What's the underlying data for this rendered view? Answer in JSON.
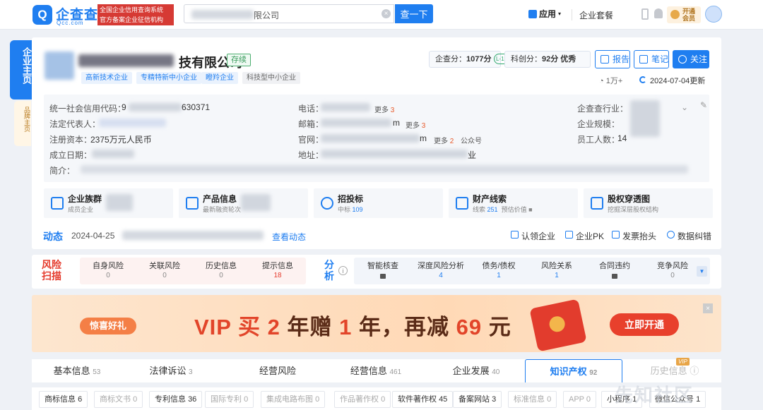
{
  "topbar": {
    "logo_text": "企查查",
    "logo_sub": "Qcc.com",
    "slogan_line1": "全国企业信用查询系统",
    "slogan_line2": "官方备案企业征信机构",
    "search_value": "限公司",
    "search_button": "查一下",
    "apps": "应用",
    "packages": "企业套餐",
    "vip_line1": "开通",
    "vip_line2": "会员"
  },
  "side_tabs": {
    "main": "企业主页",
    "brand": "品牌主页"
  },
  "company": {
    "name_suffix": "技有限公司",
    "status": "存续",
    "tags": [
      "高新技术企业",
      "专精特新中小企业",
      "瞪羚企业",
      "科技型中小企业"
    ],
    "score_label": "企查分：",
    "score_value": "1077分",
    "score_badge": "L-12",
    "tech_label": "科创分：",
    "tech_value": "92分 优秀",
    "btn_report": "报告",
    "btn_note": "笔记",
    "btn_follow": "关注",
    "views": "1万+",
    "updated": "2024-07-04更新"
  },
  "info": {
    "credit_code_label": "统一社会信用代码：",
    "credit_code_prefix": "9",
    "credit_code_suffix": "630371",
    "legal_rep_label": "法定代表人：",
    "capital_label": "注册资本：",
    "capital_value": "2375万元人民币",
    "founded_label": "成立日期：",
    "intro_label": "简介：",
    "phone_label": "电话：",
    "phone_more": "更多",
    "phone_more_count": "3",
    "email_label": "邮箱：",
    "email_tail": "m",
    "email_more": "更多",
    "email_more_count": "3",
    "website_label": "官网：",
    "website_tail": "m",
    "website_more": "更多",
    "website_more_count": "2",
    "website_extra": "公众号",
    "address_label": "地址：",
    "address_tail": "业",
    "industry_label": "企查查行业：",
    "scale_label": "企业规模：",
    "staff_label": "员工人数：",
    "staff_value": "14"
  },
  "quick_cards": [
    {
      "title": "企业族群",
      "sub": "成员企业"
    },
    {
      "title": "产品信息",
      "sub": "最新融资轮次"
    },
    {
      "title": "招投标",
      "sub_pre": "中标",
      "sub_num": "109"
    },
    {
      "title": "财产线索",
      "sub_pre": "线索",
      "sub_num": "251",
      "sub_post": "预估价值"
    },
    {
      "title": "股权穿透图",
      "sub": "挖掘深层股权结构"
    }
  ],
  "dynamic": {
    "title": "动态",
    "date": "2024-04-25",
    "link": "查看动态",
    "actions": [
      "认领企业",
      "企业PK",
      "发票抬头",
      "数据纠错"
    ]
  },
  "risk": {
    "title": "风险扫描",
    "items": [
      {
        "label": "自身风险",
        "n": "0"
      },
      {
        "label": "关联风险",
        "n": "0"
      },
      {
        "label": "历史信息",
        "n": "0"
      },
      {
        "label": "提示信息",
        "n": "18"
      }
    ]
  },
  "analysis": {
    "title": "分析",
    "items": [
      {
        "label": "智能核查",
        "n": ""
      },
      {
        "label": "深度风险分析",
        "n": "4"
      },
      {
        "label": "债务/债权",
        "n": "1"
      },
      {
        "label": "风险关系",
        "n": "1"
      },
      {
        "label": "合同违约",
        "n": ""
      },
      {
        "label": "竞争风险",
        "n": "0"
      }
    ]
  },
  "banner": {
    "tag": "惊喜好礼",
    "text_a": "VIP 买 ",
    "text_b": "2",
    "text_c": " 年赠 ",
    "text_d": "1",
    "text_e": " 年，再减 ",
    "text_f": "69",
    "text_g": " 元",
    "button": "立即开通"
  },
  "tabs": [
    {
      "label": "基本信息",
      "n": "53"
    },
    {
      "label": "法律诉讼",
      "n": "3"
    },
    {
      "label": "经营风险",
      "n": ""
    },
    {
      "label": "经营信息",
      "n": "461"
    },
    {
      "label": "企业发展",
      "n": "40"
    },
    {
      "label": "知识产权",
      "n": "92"
    },
    {
      "label": "历史信息",
      "n": ""
    }
  ],
  "tab_vip": "VIP",
  "subtabs": [
    {
      "label": "商标信息",
      "n": "6"
    },
    {
      "label": "商标文书",
      "n": "0"
    },
    {
      "label": "专利信息",
      "n": "36"
    },
    {
      "label": "国际专利",
      "n": "0"
    },
    {
      "label": "集成电路布图",
      "n": "0"
    },
    {
      "label": "作品著作权",
      "n": "0"
    },
    {
      "label": "软件著作权",
      "n": "45"
    },
    {
      "label": "备案网站",
      "n": "3"
    },
    {
      "label": "标准信息",
      "n": "0"
    },
    {
      "label": "APP",
      "n": "0"
    },
    {
      "label": "小程序",
      "n": "1"
    },
    {
      "label": "微信公众号",
      "n": "1"
    }
  ],
  "watermark": "先知社区"
}
